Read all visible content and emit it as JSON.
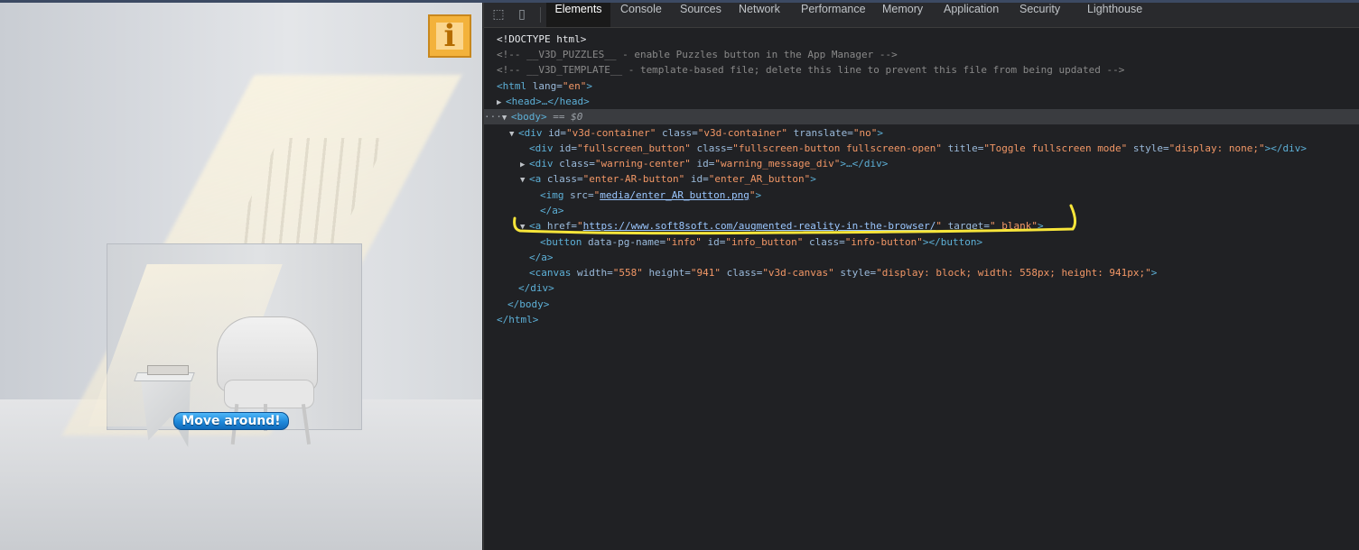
{
  "scene": {
    "move_button_label": "Move around!",
    "info_button_label": "i"
  },
  "devtools": {
    "icons": [
      "inspect-element-icon",
      "device-toolbar-icon"
    ],
    "tabs": [
      "Elements",
      "Console",
      "Sources",
      "Network",
      "Performance",
      "Memory",
      "Application",
      "Security",
      "Lighthouse"
    ],
    "active_tab": "Elements",
    "dom": {
      "doctype": "<!DOCTYPE html>",
      "comment1": "<!-- __V3D_PUZZLES__ - enable Puzzles button in the App Manager -->",
      "comment2": "<!-- __V3D_TEMPLATE__ - template-based file; delete this line to prevent this file from being updated -->",
      "html_open": "<html",
      "lang_attr": " lang=",
      "lang_val": "\"en\"",
      "head": "<head>…</head>",
      "body_open": "<body>",
      "body_sel": " == $0",
      "container": {
        "tag": "<div",
        "a1": " id=",
        "v1": "\"v3d-container\"",
        "a2": " class=",
        "v2": "\"v3d-container\"",
        "a3": " translate=",
        "v3": "\"no\"",
        "close": ">"
      },
      "fullscreen": {
        "tag": "<div",
        "a1": " id=",
        "v1": "\"fullscreen_button\"",
        "a2": " class=",
        "v2": "\"fullscreen-button fullscreen-open\"",
        "a3": " title=",
        "v3": "\"Toggle fullscreen mode\"",
        "a4": " style=",
        "v4": "\"display: none;\"",
        "close": "></div>"
      },
      "warning": {
        "tag": "<div",
        "a1": " class=",
        "v1": "\"warning-center\"",
        "a2": " id=",
        "v2": "\"warning_message_div\"",
        "close": ">…</div>"
      },
      "enter_ar": {
        "tag": "<a",
        "a1": " class=",
        "v1": "\"enter-AR-button\"",
        "a2": " id=",
        "v2": "\"enter_AR_button\"",
        "close": ">"
      },
      "img": {
        "tag": "<img",
        "a1": " src=",
        "q": "\"",
        "link": "media/enter_AR_button.png",
        "close": ">"
      },
      "a_close": "</a>",
      "href_a": {
        "tag": "<a",
        "a1": " href=",
        "q": "\"",
        "link": "https://www.soft8soft.com/augmented-reality-in-the-browser/",
        "a2": " target=",
        "v2": "\"_blank\"",
        "close": ">"
      },
      "button": {
        "tag": "<button",
        "a1": " data-pg-name=",
        "v1": "\"info\"",
        "a2": " id=",
        "v2": "\"info_button\"",
        "a3": " class=",
        "v3": "\"info-button\"",
        "close": "></button>"
      },
      "canvas": {
        "tag": "<canvas",
        "a1": " width=",
        "v1": "\"558\"",
        "a2": " height=",
        "v2": "\"941\"",
        "a3": " class=",
        "v3": "\"v3d-canvas\"",
        "a4": " style=",
        "v4": "\"display: block; width: 558px; height: 941px;\"",
        "close": ">"
      },
      "div_close": "</div>",
      "body_close": "</body>",
      "html_close": "</html>"
    }
  },
  "colors": {
    "annotation": "#f7e53a",
    "info_button": "#f3b23b",
    "move_button": "#1e88da"
  }
}
